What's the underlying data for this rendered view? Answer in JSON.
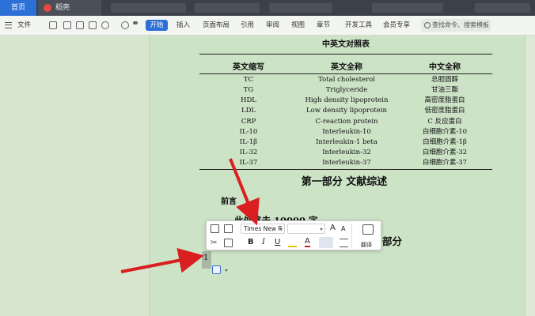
{
  "tabs": {
    "home": "首页",
    "document": "稻壳"
  },
  "ribbon": {
    "file": "文件",
    "items": [
      "开始",
      "插入",
      "页面布局",
      "引用",
      "审阅",
      "视图",
      "章节",
      "开发工具",
      "会员专享"
    ],
    "search_placeholder": "查找命令、搜索模板"
  },
  "document": {
    "table_title": "中英文对照表",
    "headers": [
      "英文缩写",
      "英文全称",
      "中文全称"
    ],
    "rows": [
      [
        "TC",
        "Total cholesterol",
        "总胆固醇"
      ],
      [
        "TG",
        "Triglyceride",
        "甘油三酯"
      ],
      [
        "HDL",
        "High density lipoprotein",
        "高密度脂蛋白"
      ],
      [
        "LDL",
        "Low density lipoprotein",
        "低密度脂蛋白"
      ],
      [
        "CRP",
        "C-reaction protein",
        "C  反应蛋白"
      ],
      [
        "IL-10",
        "Interleukin-10",
        "白细胞介素-10"
      ],
      [
        "IL-1β",
        "Interleukin-1 beta",
        "白细胞介素-1β"
      ],
      [
        "IL-32",
        "Interleukin-32",
        "白细胞介素-32"
      ],
      [
        "IL-37",
        "Interleukin-37",
        "白细胞介素-37"
      ]
    ],
    "section1": "第一部分  文献综述",
    "preface": "前言",
    "partial_line": "此处略去 10000 字",
    "section2_tail": "部分",
    "cursor_text": "1"
  },
  "mini_toolbar": {
    "font": "Times New R",
    "bold": "B",
    "italic": "I",
    "underline": "U",
    "font_color": "A",
    "translate": "翻译"
  },
  "colors": {
    "accent": "#2c6fd6",
    "arrow": "#d91f1f",
    "page_bg": "#cde3c6"
  }
}
